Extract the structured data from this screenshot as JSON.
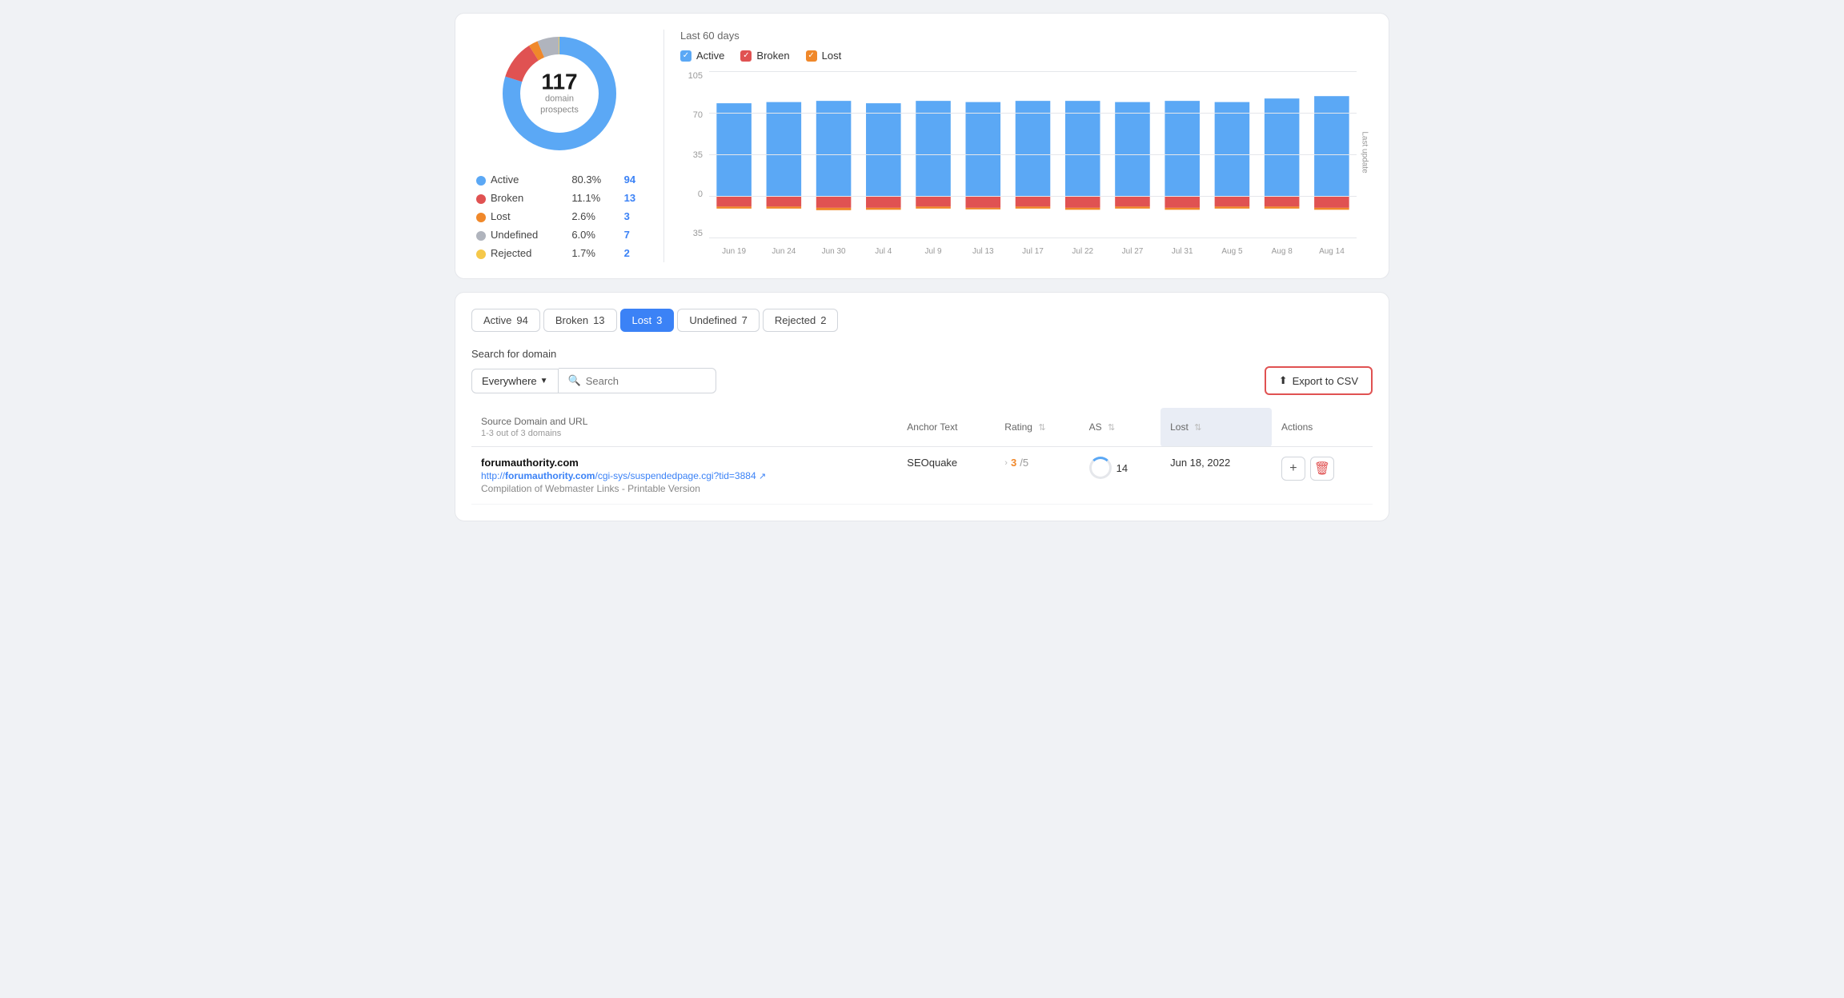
{
  "donut": {
    "center_number": "117",
    "center_label": "domain\nprospects",
    "segments": [
      {
        "label": "Active",
        "color": "#5ba8f5",
        "percent": 80.3,
        "count": 94,
        "offset": 0,
        "dash": 251
      },
      {
        "label": "Broken",
        "color": "#e05252",
        "percent": 11.1,
        "count": 13,
        "offset": 251,
        "dash": 35
      },
      {
        "label": "Lost",
        "color": "#f0882a",
        "percent": 2.6,
        "count": 3,
        "offset": 286,
        "dash": 8
      },
      {
        "label": "Undefined",
        "color": "#b0b4bd",
        "percent": 6.0,
        "count": 7,
        "offset": 294,
        "dash": 19
      },
      {
        "label": "Rejected",
        "color": "#f5c84a",
        "percent": 1.7,
        "count": 2,
        "offset": 313,
        "dash": 5
      }
    ]
  },
  "chart": {
    "period_label": "Last 60 days",
    "legend": [
      {
        "label": "Active",
        "color": "#5ba8f5",
        "checked": true
      },
      {
        "label": "Broken",
        "color": "#e05252",
        "checked": true
      },
      {
        "label": "Lost",
        "color": "#f0882a",
        "checked": true
      }
    ],
    "y_labels": [
      "105",
      "70",
      "35",
      "0",
      "35"
    ],
    "x_labels": [
      "Jun 19",
      "Jun 24",
      "Jun 30",
      "Jul 4",
      "Jul 9",
      "Jul 13",
      "Jul 17",
      "Jul 22",
      "Jul 27",
      "Jul 31",
      "Aug 5",
      "Aug 8",
      "Aug 14"
    ],
    "bars": [
      {
        "active": 78,
        "broken": 9,
        "lost": 5
      },
      {
        "active": 79,
        "broken": 9,
        "lost": 5
      },
      {
        "active": 80,
        "broken": 10,
        "lost": 6
      },
      {
        "active": 78,
        "broken": 10,
        "lost": 5
      },
      {
        "active": 80,
        "broken": 9,
        "lost": 5
      },
      {
        "active": 79,
        "broken": 10,
        "lost": 4
      },
      {
        "active": 80,
        "broken": 9,
        "lost": 5
      },
      {
        "active": 80,
        "broken": 10,
        "lost": 5
      },
      {
        "active": 79,
        "broken": 9,
        "lost": 5
      },
      {
        "active": 80,
        "broken": 10,
        "lost": 5
      },
      {
        "active": 79,
        "broken": 9,
        "lost": 5
      },
      {
        "active": 82,
        "broken": 9,
        "lost": 5
      },
      {
        "active": 84,
        "broken": 10,
        "lost": 5
      }
    ]
  },
  "tabs": [
    {
      "label": "Active",
      "count": "94",
      "active": false
    },
    {
      "label": "Broken",
      "count": "13",
      "active": false
    },
    {
      "label": "Lost",
      "count": "3",
      "active": true
    },
    {
      "label": "Undefined",
      "count": "7",
      "active": false
    },
    {
      "label": "Rejected",
      "count": "2",
      "active": false
    }
  ],
  "search": {
    "label": "Search for domain",
    "dropdown_value": "Everywhere",
    "placeholder": "Search",
    "export_label": "Export to CSV"
  },
  "table": {
    "columns": [
      {
        "label": "Source Domain and URL",
        "sub": "1-3 out of 3 domains",
        "sort": false
      },
      {
        "label": "Anchor Text",
        "sort": false
      },
      {
        "label": "Rating",
        "sort": true
      },
      {
        "label": "AS",
        "sort": true
      },
      {
        "label": "Lost",
        "sort": true,
        "highlight": true
      },
      {
        "label": "Actions",
        "sort": false
      }
    ],
    "rows": [
      {
        "domain": "forumauthority.com",
        "url": "http://forumauthority.com/cgi-sys/suspendedpage.cgi?tid=3884",
        "description": "Compilation of Webmaster Links - Printable Version",
        "anchor_text": "SEOquake",
        "rating_val": "3/5",
        "as_val": "14",
        "lost_date": "Jun 18, 2022"
      }
    ]
  }
}
